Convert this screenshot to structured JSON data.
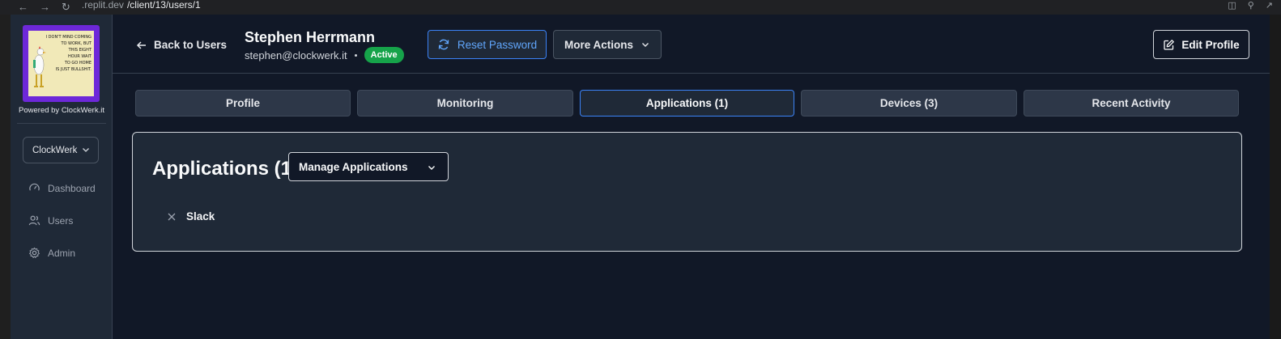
{
  "browser": {
    "url_host": ".replit.dev",
    "url_path": "/client/13/users/1"
  },
  "sidebar": {
    "logo_text": "I DON'T MIND COMING TO WORK, BUT THIS EIGHT HOUR WAIT TO GO HOME IS JUST BULLSHIT.",
    "powered_by": "Powered by ClockWerk.it",
    "org_selector": "ClockWerk",
    "items": [
      {
        "label": "Dashboard",
        "icon": "gauge-icon"
      },
      {
        "label": "Users",
        "icon": "users-icon"
      },
      {
        "label": "Admin",
        "icon": "gear-icon"
      }
    ]
  },
  "header": {
    "back_label": "Back to Users",
    "user_name": "Stephen Herrmann",
    "user_email": "stephen@clockwerk.it",
    "status": "Active",
    "reset_password": "Reset Password",
    "more_actions": "More Actions",
    "edit_profile": "Edit Profile"
  },
  "tabs": [
    {
      "label": "Profile",
      "active": false
    },
    {
      "label": "Monitoring",
      "active": false
    },
    {
      "label": "Applications (1)",
      "active": true
    },
    {
      "label": "Devices (3)",
      "active": false
    },
    {
      "label": "Recent Activity",
      "active": false
    }
  ],
  "applications": {
    "title": "Applications (1)",
    "manage_label": "Manage Applications",
    "items": [
      {
        "name": "Slack"
      }
    ]
  },
  "colors": {
    "accent": "#3b82f6",
    "status_active": "#16a34a",
    "logo_bg": "#6d28d9"
  }
}
